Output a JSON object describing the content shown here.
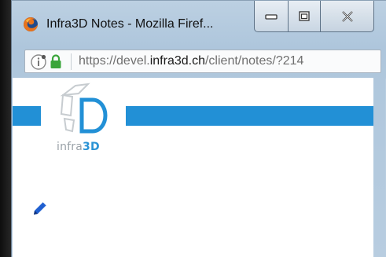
{
  "window": {
    "title": "Infra3D Notes - Mozilla Firef...",
    "controls": {
      "minimize_icon": "minimize-icon",
      "maximize_icon": "maximize-icon",
      "close_icon": "close-icon"
    }
  },
  "urlbar": {
    "url_prefix": "https://devel.",
    "url_domain": "infra3d.ch",
    "url_suffix": "/client/notes/?214",
    "icons": [
      "info-icon",
      "lock-icon"
    ]
  },
  "page": {
    "logo": {
      "text_main": "infra",
      "text_accent": "3D"
    },
    "edit_icon": "pencil-icon"
  },
  "colors": {
    "brand_blue": "#2290d6",
    "logo_grey": "#9aa2a8",
    "lock_green": "#3aa53a"
  }
}
